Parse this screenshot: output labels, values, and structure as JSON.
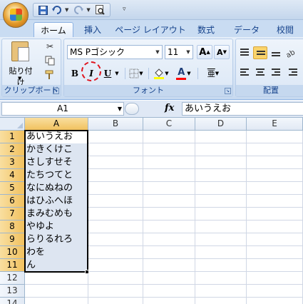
{
  "qat": {
    "save_icon": "save-icon",
    "undo_icon": "undo-icon",
    "redo_icon": "redo-icon",
    "preview_icon": "print-preview-icon"
  },
  "tabs": [
    {
      "label": "ホーム",
      "active": true
    },
    {
      "label": "挿入"
    },
    {
      "label": "ページ レイアウト"
    },
    {
      "label": "数式"
    },
    {
      "label": "データ"
    },
    {
      "label": "校閲"
    }
  ],
  "ribbon": {
    "clipboard": {
      "paste_label": "貼り付け",
      "group_label": "クリップボード"
    },
    "font": {
      "font_name": "MS Pゴシック",
      "font_size": "11",
      "bold": "B",
      "italic": "I",
      "underline": "U",
      "group_label": "フォント",
      "grow": "A",
      "shrink": "A"
    },
    "alignment": {
      "group_label": "配置"
    },
    "accent_color": "#e0141e",
    "fill_color": "#ffff00",
    "font_color": "#ff0000"
  },
  "formula_bar": {
    "name_box": "A1",
    "fx_label": "fx",
    "formula": "あいうえお"
  },
  "sheet": {
    "columns": [
      "A",
      "B",
      "C",
      "D",
      "E"
    ],
    "rows": [
      "1",
      "2",
      "3",
      "4",
      "5",
      "6",
      "7",
      "8",
      "9",
      "10",
      "11",
      "12",
      "13",
      "14"
    ],
    "column_a": [
      "あいうえお",
      "かきくけこ",
      "さしすせそ",
      "たちつてと",
      "なにぬねの",
      "はひふへほ",
      "まみむめも",
      "やゆよ",
      "らりるれろ",
      "わを",
      "ん"
    ]
  }
}
